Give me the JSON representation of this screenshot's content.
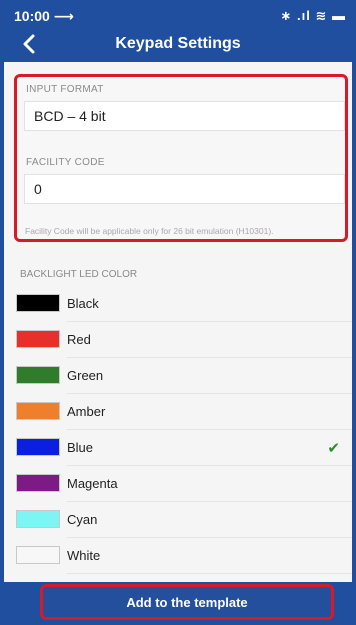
{
  "status_bar": {
    "time": "10:00 ⟶",
    "icons": "∗ .ıl ≋ ▬"
  },
  "nav": {
    "title": "Keypad Settings",
    "back_icon": "chevron-left-icon"
  },
  "input_format": {
    "label": "INPUT FORMAT",
    "value": "BCD – 4 bit"
  },
  "facility_code": {
    "label": "FACILITY CODE",
    "value": "0",
    "note": "Facility Code will be applicable only for 26 bit emulation (H10301)."
  },
  "backlight": {
    "label": "BACKLIGHT LED COLOR",
    "colors": [
      {
        "name": "Black",
        "hex": "#000000",
        "selected": false
      },
      {
        "name": "Red",
        "hex": "#e8302a",
        "selected": false
      },
      {
        "name": "Green",
        "hex": "#2f7d2a",
        "selected": false
      },
      {
        "name": "Amber",
        "hex": "#ee7f2d",
        "selected": false
      },
      {
        "name": "Blue",
        "hex": "#0b1fe0",
        "selected": true
      },
      {
        "name": "Magenta",
        "hex": "#7e1a86",
        "selected": false
      },
      {
        "name": "Cyan",
        "hex": "#7df5f5",
        "selected": false
      },
      {
        "name": "White",
        "hex": "#f7f7f7",
        "selected": false
      }
    ]
  },
  "footer": {
    "add_button": "Add to the template"
  },
  "theme": {
    "primary": "#1f4f9e",
    "highlight": "#d71a2a",
    "check": "#2e8b2e"
  }
}
